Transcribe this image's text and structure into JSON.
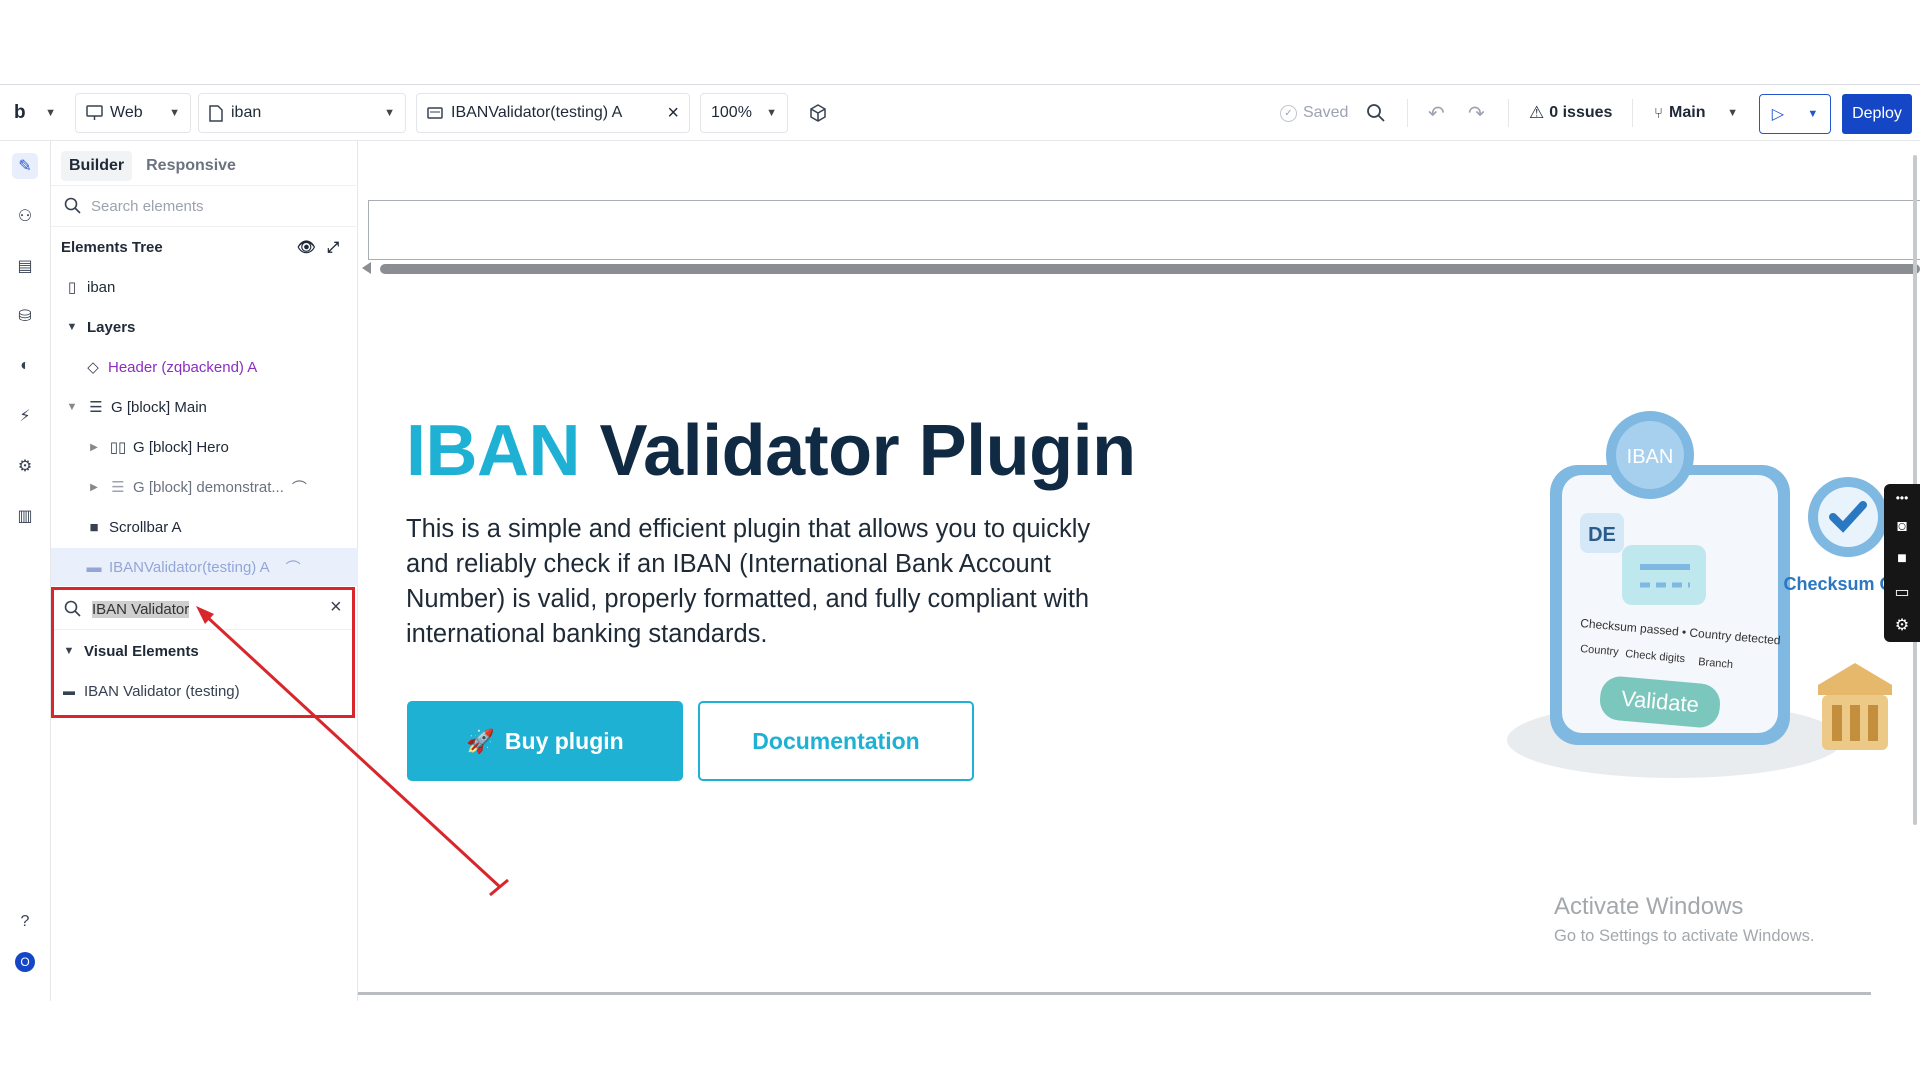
{
  "toolbar": {
    "logo": "b",
    "platform": "Web",
    "page": "iban",
    "element_tab": "IBANValidator(testing) A",
    "zoom": "100%",
    "saved": "Saved",
    "issues": "0 issues",
    "branch": "Main",
    "deploy": "Deploy"
  },
  "panel": {
    "tabs": [
      "Builder",
      "Responsive"
    ],
    "search_placeholder": "Search elements",
    "tree_title": "Elements Tree",
    "tree": [
      {
        "label": "iban",
        "kind": "page"
      },
      {
        "label": "Layers",
        "kind": "group"
      },
      {
        "label": "Header (zqbackend) A",
        "kind": "component"
      },
      {
        "label": "G [block] Main",
        "kind": "block"
      },
      {
        "label": "G [block] Hero",
        "kind": "columns"
      },
      {
        "label": "G [block] demonstrat...",
        "kind": "block"
      },
      {
        "label": "Scrollbar A",
        "kind": "element"
      },
      {
        "label": "IBANValidator(testing) A",
        "kind": "plugin"
      }
    ],
    "search2_value": "IBAN Validator",
    "visual_elements": "Visual Elements",
    "result": "IBAN Validator (testing)"
  },
  "hero": {
    "title_accent": "IBAN",
    "title_rest": "Validator Plugin",
    "description": "This is a simple and efficient plugin that allows you to quickly and reliably check if an IBAN (International Bank Account Number) is valid, properly formatted, and fully compliant with international banking standards.",
    "buy": "Buy plugin",
    "docs": "Documentation"
  },
  "illustration": {
    "badge": "IBAN",
    "country": "DE",
    "line1": "Checksum passed • Country detected",
    "chips": [
      "Country",
      "Check digits",
      "Branch"
    ],
    "button": "Validate",
    "checksum": "Checksum OK"
  },
  "watermark": {
    "line1": "Activate Windows",
    "line2": "Go to Settings to activate Windows."
  },
  "colors": {
    "accent": "#1eb1d4",
    "deploy": "#1546c5",
    "highlight": "#d8262b"
  }
}
